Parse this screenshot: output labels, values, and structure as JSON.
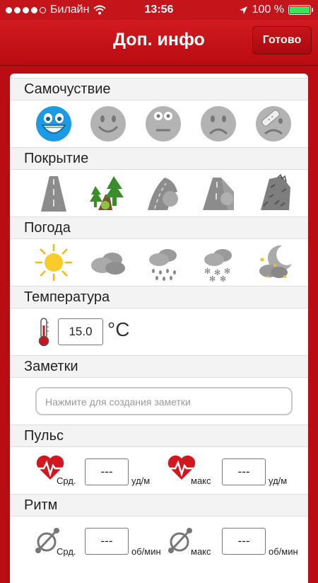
{
  "status_bar": {
    "carrier": "Билайн",
    "time": "13:56",
    "battery": "100 %",
    "battery_level": 1.0
  },
  "navbar": {
    "title": "Доп. инфо",
    "done_label": "Готово"
  },
  "sections": {
    "wellbeing": {
      "label": "Самочуствие",
      "icons": [
        "smiley-very-happy-icon",
        "smiley-happy-icon",
        "smiley-neutral-icon",
        "smiley-sad-icon",
        "smiley-injured-icon"
      ]
    },
    "surface": {
      "label": "Покрытие",
      "icons": [
        "road-flat-icon",
        "road-forest-icon",
        "road-hill-icon",
        "road-mountain-icon",
        "road-rough-icon"
      ]
    },
    "weather": {
      "label": "Погода",
      "icons": [
        "sun-icon",
        "cloud-icon",
        "rain-icon",
        "snow-icon",
        "night-icon"
      ]
    },
    "temperature": {
      "label": "Температура",
      "value": "15.0",
      "unit": "°C"
    },
    "notes": {
      "label": "Заметки",
      "placeholder": "Нажмите для создания заметки"
    },
    "pulse": {
      "label": "Пульс",
      "avg_label": "Срд.",
      "max_label": "макс",
      "avg_value": "---",
      "max_value": "---",
      "unit": "уд/м"
    },
    "rhythm": {
      "label": "Ритм",
      "avg_label": "Срд.",
      "max_label": "макс",
      "avg_value": "---",
      "max_value": "---",
      "unit": "об/мин"
    }
  },
  "colors": {
    "brand_red": "#c4151b",
    "selected_blue": "#1c9ae4",
    "icon_gray": "#9a9a9a",
    "heart_red": "#d0181e"
  }
}
